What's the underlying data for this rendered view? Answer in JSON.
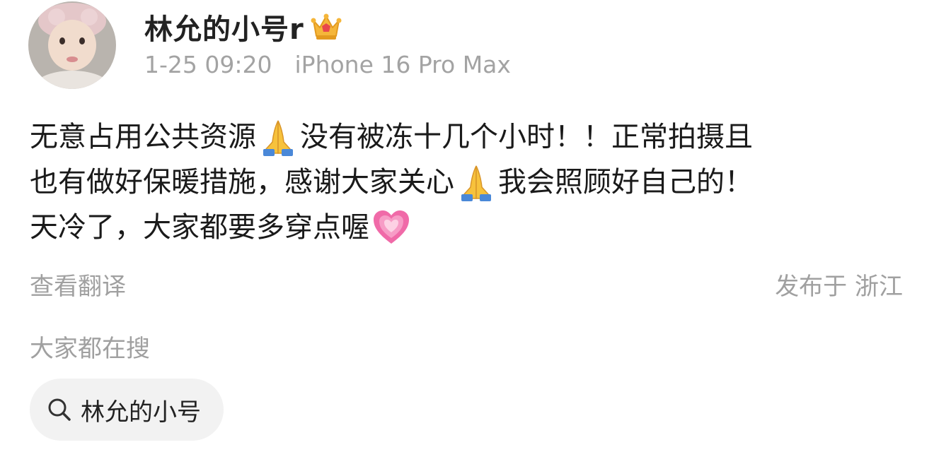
{
  "user": {
    "name": "林允的小号r",
    "badge_icon": "crown-icon",
    "avatar_icon": "avatar"
  },
  "meta": {
    "timestamp": "1-25 09:20",
    "device": "iPhone 16 Pro Max"
  },
  "post": {
    "segments": {
      "s1": "无意占用公共资源",
      "s2": "没有被冻十几个小时！！正常拍摄且",
      "s3": "也有做好保暖措施，感谢大家关心",
      "s4": "我会照顾好自己的！",
      "s5": "天冷了，大家都要多穿点喔"
    },
    "emoji_icons": [
      "praying-hands-icon",
      "praying-hands-icon",
      "growing-heart-icon"
    ]
  },
  "actions": {
    "translate_label": "查看翻译",
    "location_label": "发布于 浙江"
  },
  "trending": {
    "label": "大家都在搜",
    "search_chip": {
      "icon": "search-icon",
      "text": "林允的小号"
    }
  },
  "colors": {
    "meta_gray": "#a3a3a3",
    "chip_bg": "#f2f2f2",
    "text_primary": "#1a1a1a"
  }
}
